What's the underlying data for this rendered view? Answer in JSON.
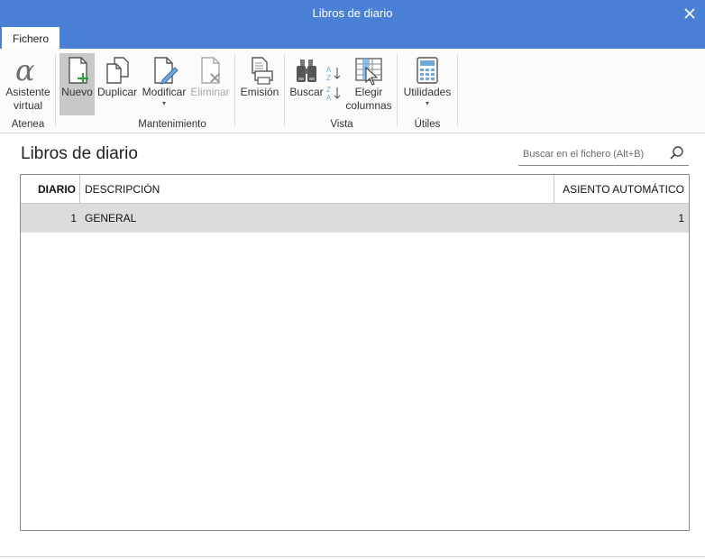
{
  "window": {
    "title": "Libros de diario"
  },
  "tabs": [
    {
      "label": "Fichero"
    }
  ],
  "ribbon": {
    "atenea": {
      "label": "Atenea",
      "asistente_line1": "Asistente",
      "asistente_line2": "virtual"
    },
    "mantenimiento": {
      "label": "Mantenimiento",
      "nuevo": "Nuevo",
      "duplicar": "Duplicar",
      "modificar": "Modificar",
      "eliminar": "Eliminar",
      "emision": "Emisión"
    },
    "vista": {
      "label": "Vista",
      "buscar": "Buscar",
      "elegir_line1": "Elegir",
      "elegir_line2": "columnas"
    },
    "utiles": {
      "label": "Útiles",
      "utilidades": "Utilidades"
    }
  },
  "page": {
    "title": "Libros de diario"
  },
  "search": {
    "placeholder": "Buscar en el fichero (Alt+B)"
  },
  "table": {
    "columns": [
      "DIARIO",
      "DESCRIPCIÓN",
      "ASIENTO AUTOMÁTICO"
    ],
    "rows": [
      {
        "diario": "1",
        "descripcion": "GENERAL",
        "asiento": "1"
      }
    ]
  },
  "colors": {
    "titlebar": "#4a7fd6",
    "selected_row": "#dcdcdc",
    "nuevo_active": "#c8c8c8",
    "plus_green": "#2e9a3e"
  }
}
